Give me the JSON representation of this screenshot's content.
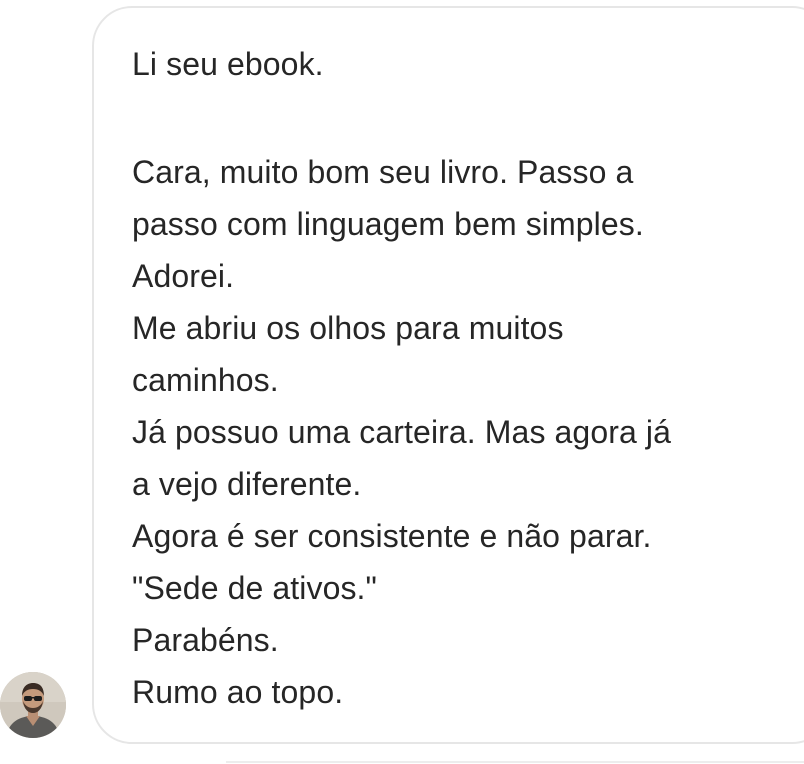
{
  "message": {
    "lines": [
      "Li seu ebook.",
      "",
      "Cara, muito bom seu livro. Passo a",
      "passo com linguagem bem simples.",
      "Adorei.",
      "Me abriu os olhos para muitos",
      "caminhos.",
      "Já possuo uma carteira. Mas agora já",
      "a vejo diferente.",
      "Agora é ser consistente e não parar.",
      "\"Sede de ativos.\"",
      "Parabéns.",
      "Rumo ao topo."
    ]
  },
  "sender": {
    "avatar_icon": "user-avatar-photo"
  },
  "colors": {
    "text": "#262626",
    "bubble_border": "#e6e6e6",
    "background": "#ffffff"
  }
}
